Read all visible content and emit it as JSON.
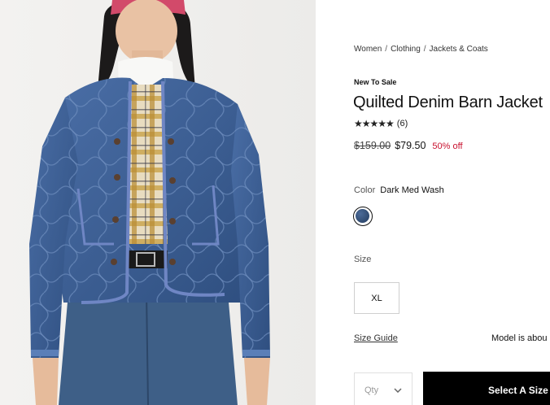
{
  "breadcrumb": [
    "Women",
    "Clothing",
    "Jackets & Coats"
  ],
  "product": {
    "promo_tag": "New To Sale",
    "title": "Quilted Denim Barn Jacket",
    "rating_count": "(6)",
    "rating_stars": "★★★★★",
    "original_price": "$159.00",
    "sale_price": "$79.50",
    "discount": "50% off"
  },
  "color": {
    "label": "Color",
    "selected": "Dark Med Wash",
    "swatch_hex": "#35527d"
  },
  "size": {
    "label": "Size",
    "options": [
      "XL"
    ]
  },
  "links": {
    "size_guide": "Size Guide",
    "model_info": "Model is abou"
  },
  "purchase": {
    "qty_placeholder": "Qty",
    "cta_label": "Select A Size"
  },
  "colors": {
    "sale_red": "#c8102e",
    "cta_bg": "#000000",
    "denim": "#3d5f95"
  }
}
